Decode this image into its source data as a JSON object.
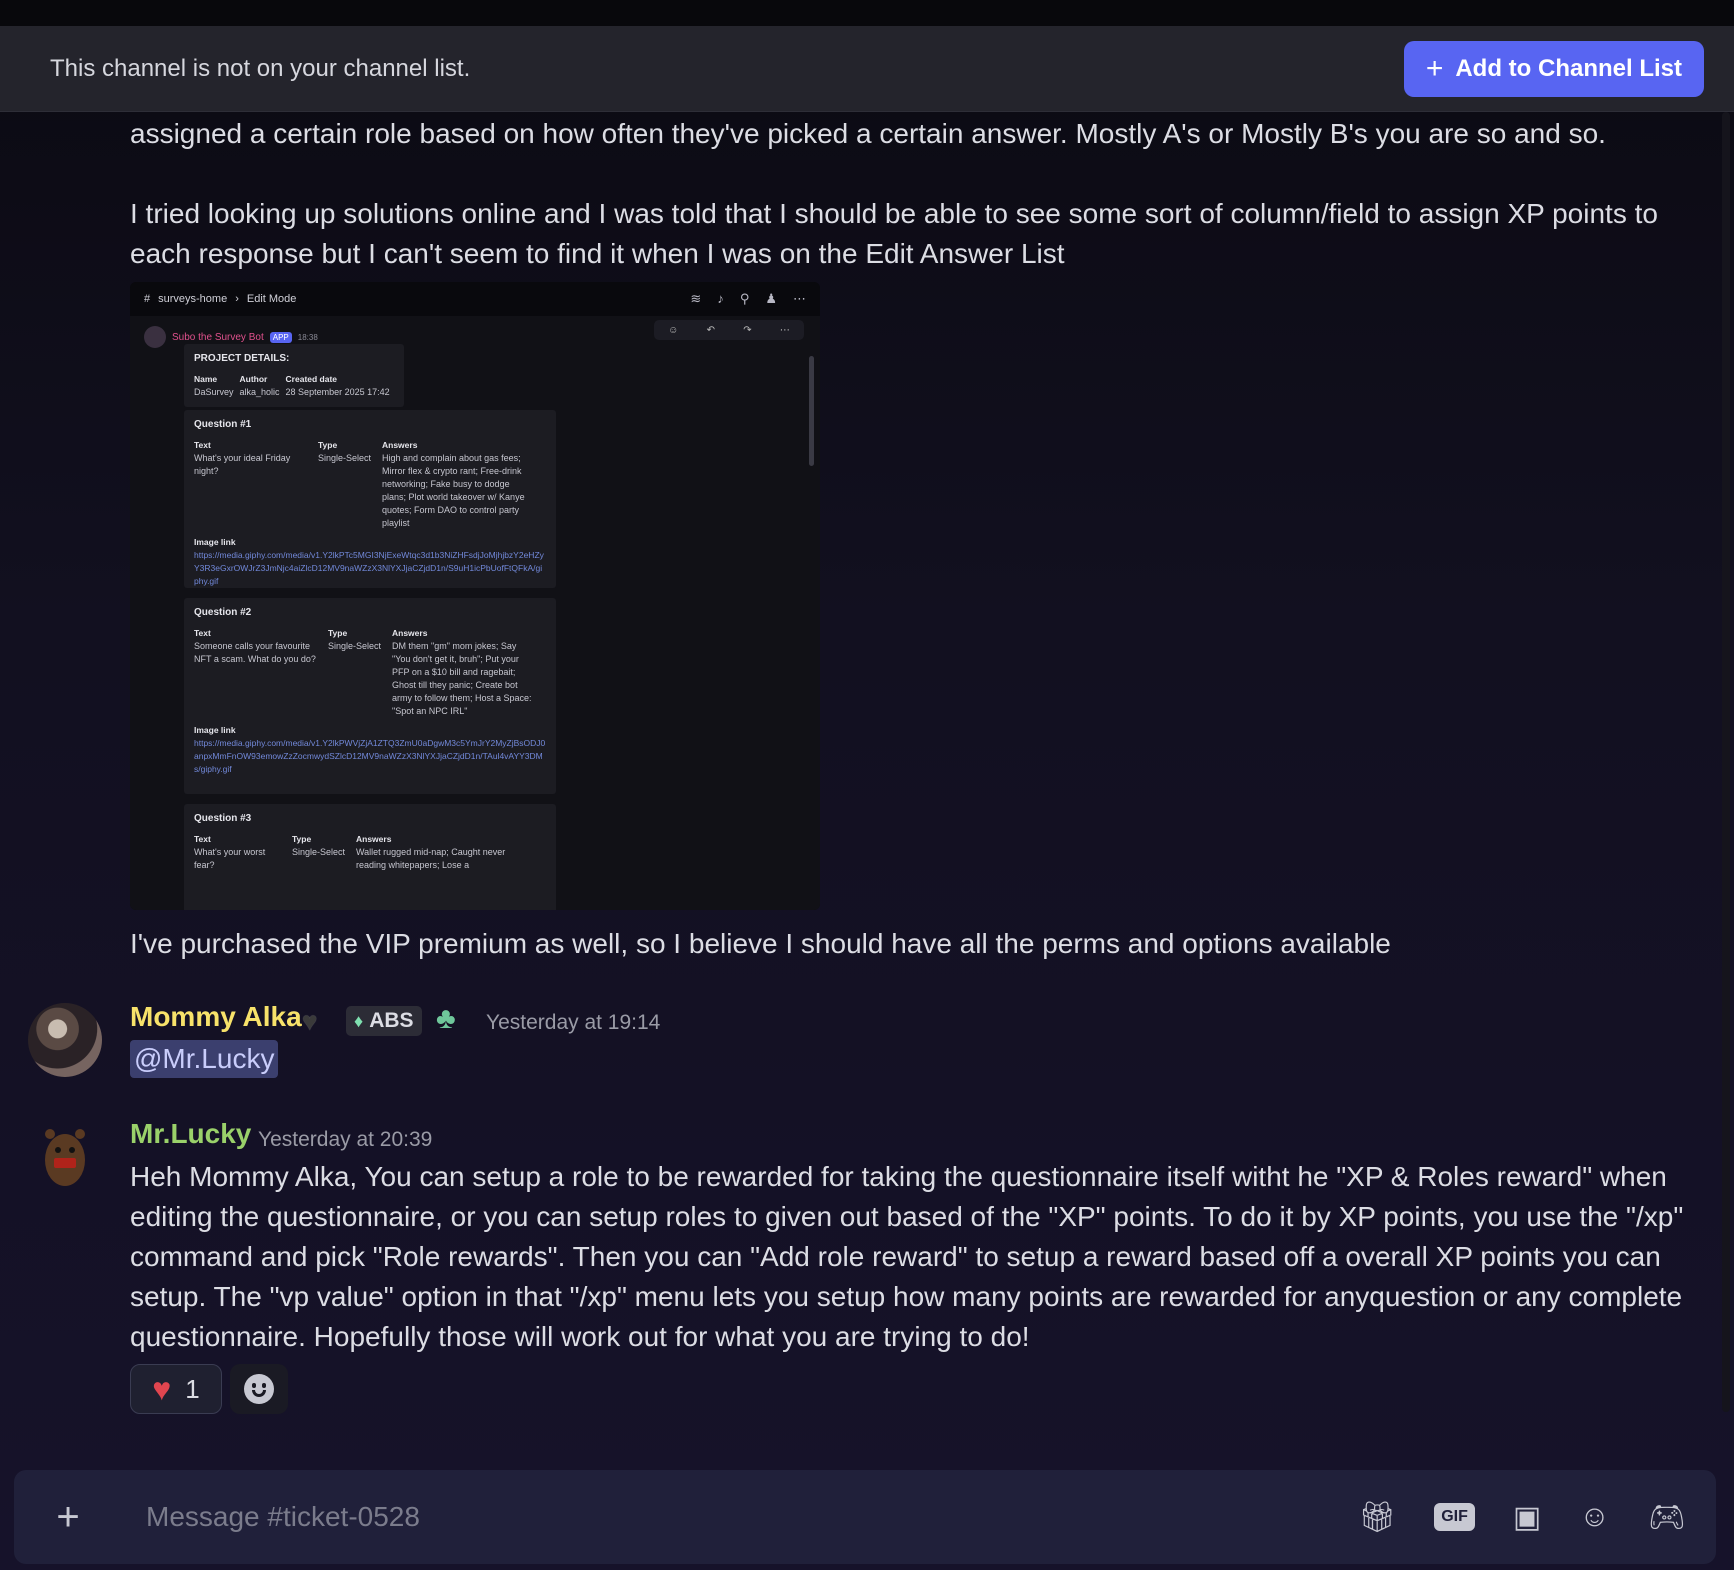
{
  "notice": {
    "text": "This channel is not on your channel list.",
    "button": "Add to Channel List"
  },
  "messages": {
    "intro_line": "assigned a certain role based on how often they've picked a certain answer. Mostly A's or Mostly B's you are so and so.",
    "paragraph": "I tried looking up solutions online and I was told that I should be able to see some sort of column/field to assign XP points to each response but I can't seem to find it when I was on the Edit Answer List",
    "followup": "I've purchased the VIP premium as well, so I believe I should have all the perms and options available"
  },
  "screenshot": {
    "channel": "surveys-home",
    "mode": "Edit Mode",
    "bot_name": "Subo the Survey Bot",
    "bot_badge": "APP",
    "bot_time": "18:38",
    "project": {
      "title": "PROJECT DETAILS:",
      "headers": [
        "Name",
        "Author",
        "Created date"
      ],
      "values": [
        "DaSurvey",
        "alka_holic",
        "28 September 2025 17:42"
      ]
    },
    "q1": {
      "title": "Question #1",
      "text": "What's your ideal Friday night?",
      "type": "Single-Select",
      "answers": "High and complain about gas fees; Mirror flex & crypto rant; Free-drink networking; Fake busy to dodge plans; Plot world takeover w/ Kanye quotes; Form DAO to control party playlist",
      "image_link": "https://media.giphy.com/media/v1.Y2lkPTc5MGI3NjExeWtqc3d1b3NiZHFsdjJoMjhjbzY2eHZyY3R3eGxrOWJrZ3JmNjc4aiZlcD12MV9naWZzX3NlYXJjaCZjdD1n/S9uH1icPbUofFtQFkA/giphy.gif"
    },
    "q2": {
      "title": "Question #2",
      "text": "Someone calls your favourite NFT a scam. What do you do?",
      "type": "Single-Select",
      "answers": "DM them \"gm\" mom jokes; Say \"You don't get it, bruh\"; Put your PFP on a $10 bill and ragebait; Ghost till they panic; Create bot army to follow them; Host a Space: \"Spot an NPC IRL\"",
      "image_link": "https://media.giphy.com/media/v1.Y2lkPWVjZjA1ZTQ3ZmU0aDgwM3c5YmJrY2MyZjBsODJ0anpxMmFnOW93emowZzZocmwydSZlcD12MV9naWZzX3NlYXJjaCZjdD1n/TAul4vAYY3DMs/giphy.gif"
    },
    "q3": {
      "title": "Question #3",
      "text": "What's your worst fear?",
      "type": "Single-Select",
      "answers": "Wallet rugged mid-nap; Caught never reading whitepapers; Lose a"
    },
    "labels": {
      "text": "Text",
      "type": "Type",
      "answers": "Answers",
      "image_link": "Image link"
    }
  },
  "msg_alka": {
    "name": "Mommy Alka",
    "tag": "ABS",
    "timestamp": "Yesterday at 19:14",
    "mention": "@Mr.Lucky"
  },
  "msg_lucky": {
    "name": "Mr.Lucky",
    "timestamp": "Yesterday at 20:39",
    "body": "Heh Mommy Alka,  You can setup a role to be rewarded for taking the questionnaire itself witht he \"XP & Roles reward\" when editing the questionnaire, or you can setup roles to given out based of the \"XP\" points.  To do it by XP points, you use the \"/xp\" command and pick \"Role rewards\".  Then you can \"Add role reward\" to setup a reward based off a overall XP points you can setup.  The \"vp value\" option in that \"/xp\" menu lets you setup how many points are rewarded for anyquestion or any complete questionnaire.  Hopefully those will work out for what you are trying to do!",
    "reaction_count": "1"
  },
  "composer": {
    "placeholder": "Message #ticket-0528",
    "gif_label": "GIF"
  },
  "colors": {
    "accent": "#5865f2",
    "alka_name": "#f7e26a",
    "lucky_name": "#9ad16a"
  }
}
